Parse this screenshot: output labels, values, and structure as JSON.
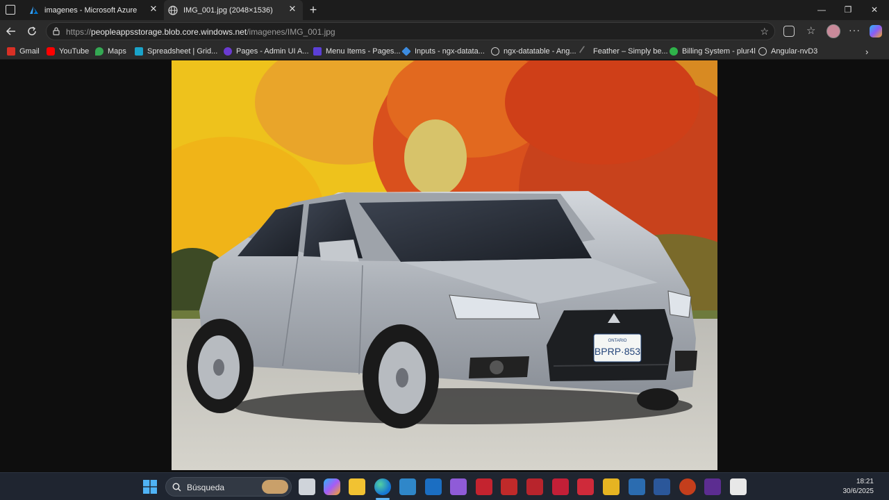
{
  "tabs": [
    {
      "title": "imagenes - Microsoft Azure",
      "icon": "azure-icon"
    },
    {
      "title": "IMG_001.jpg (2048×1536)",
      "icon": "globe-icon"
    }
  ],
  "address": {
    "prefix": "https://",
    "host": "peopleappsstorage.blob.core.windows.net",
    "path": "/imagenes/IMG_001.jpg"
  },
  "bookmarks": [
    {
      "label": "Gmail",
      "color": "#d93025"
    },
    {
      "label": "YouTube",
      "color": "#ff0000"
    },
    {
      "label": "Maps",
      "color": "#34a853"
    },
    {
      "label": "Spreadsheet | Grid...",
      "color": "#1aa3c9"
    },
    {
      "label": "Pages - Admin UI A...",
      "color": "#6a3bd1"
    },
    {
      "label": "Menu Items - Pages...",
      "color": "#5b3fd6"
    },
    {
      "label": "Inputs - ngx-datata...",
      "color": "#3d8ce0"
    },
    {
      "label": "ngx-datatable - Ang...",
      "color": "#cccccc"
    },
    {
      "label": "Feather – Simply be...",
      "color": "#555555"
    },
    {
      "label": "Billing System - plur4l",
      "color": "#2fb34a"
    },
    {
      "label": "Angular-nvD3",
      "color": "#cccccc"
    }
  ],
  "image": {
    "license_plate": "BPRP·853",
    "plate_region": "ONTARIO"
  },
  "taskbar": {
    "search_label": "Búsqueda",
    "time": "18:21",
    "date": "30/6/2025"
  },
  "colors": {
    "accent": "#0078d4"
  }
}
